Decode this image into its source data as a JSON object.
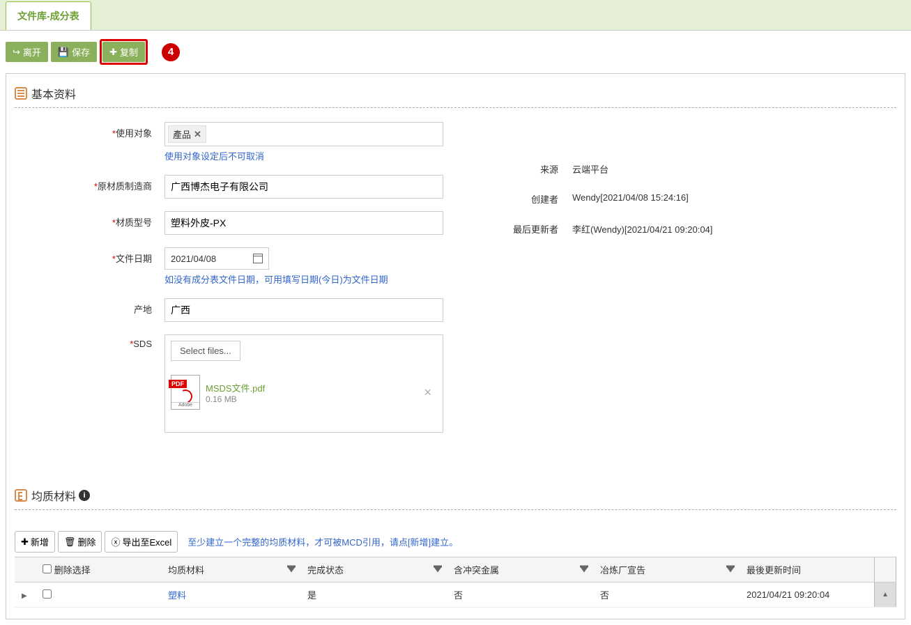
{
  "tab": {
    "title": "文件库-成分表"
  },
  "toolbar": {
    "leave": "离开",
    "save": "保存",
    "copy": "复制",
    "callout": "4"
  },
  "section_basic": "基本资料",
  "form": {
    "use_target": {
      "label": "使用对象",
      "value": "產品",
      "hint": "使用对象设定后不可取消"
    },
    "manufacturer": {
      "label": "原材质制造商",
      "value": "广西博杰电子有限公司"
    },
    "material_no": {
      "label": "材质型号",
      "value": "塑料外皮-PX"
    },
    "file_date": {
      "label": "文件日期",
      "value": "2021/04/08",
      "hint": "如没有成分表文件日期，可用填写日期(今日)为文件日期"
    },
    "origin": {
      "label": "产地",
      "value": "广西"
    },
    "sds": {
      "label": "SDS",
      "select": "Select files...",
      "file_name": "MSDS文件.pdf",
      "file_size": "0.16 MB"
    }
  },
  "info": {
    "source_label": "来源",
    "source_value": "云端平台",
    "creator_label": "创建者",
    "creator_value": "Wendy[2021/04/08 15:24:16]",
    "updater_label": "最后更新者",
    "updater_value": "李红(Wendy)[2021/04/21 09:20:04]"
  },
  "section_materials": "均质材料",
  "table_toolbar": {
    "add": "新增",
    "delete": "删除",
    "export": "导出至Excel",
    "hint": "至少建立一个完整的均质材料，才可被MCD引用，请点[新增]建立。"
  },
  "table": {
    "headers": {
      "delete_sel": "删除选择",
      "material": "均质材料",
      "status": "完成状态",
      "conflict": "含冲突金属",
      "smelter": "冶炼厂宣告",
      "updated": "最後更新时间"
    },
    "row": {
      "material": "塑料",
      "status": "是",
      "conflict": "否",
      "smelter": "否",
      "updated": "2021/04/21 09:20:04"
    }
  }
}
